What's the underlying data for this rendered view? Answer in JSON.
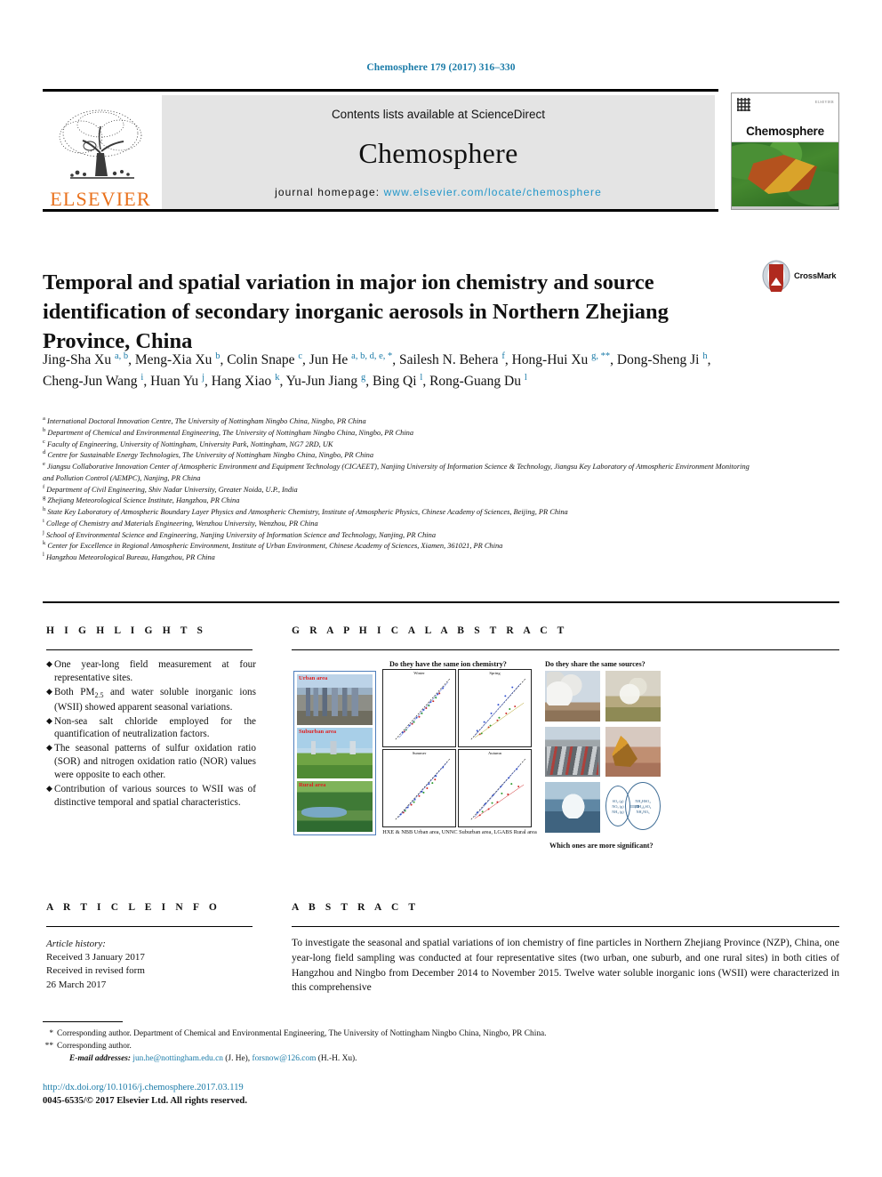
{
  "running_head": "Chemosphere 179 (2017) 316–330",
  "masthead": {
    "contents_prefix": "Contents lists available at ",
    "sciencedirect": "ScienceDirect",
    "journal_title": "Chemosphere",
    "homepage_prefix": "journal homepage: ",
    "homepage_url": "www.elsevier.com/locate/chemosphere",
    "publisher": "ELSEVIER",
    "cover_journal_name": "Chemosphere",
    "cover_publisher_mark": "ELSEVIER"
  },
  "crossmark": {
    "label": "CrossMark"
  },
  "article": {
    "title": "Temporal and spatial variation in major ion chemistry and source identification of secondary inorganic aerosols in Northern Zhejiang Province, China",
    "authors": [
      {
        "name": "Jing-Sha Xu",
        "sup": "a, b",
        "sep": ", "
      },
      {
        "name": "Meng-Xia Xu",
        "sup": "b",
        "sep": ", "
      },
      {
        "name": "Colin Snape",
        "sup": "c",
        "sep": ", "
      },
      {
        "name": "Jun He",
        "sup": "a, b, d, e, *",
        "sep": ", "
      },
      {
        "name": "Sailesh N. Behera",
        "sup": "f",
        "sep": ", "
      },
      {
        "name": "Hong-Hui Xu",
        "sup": "g, **",
        "sep": ", "
      },
      {
        "name": "Dong-Sheng Ji",
        "sup": "h",
        "sep": ", "
      },
      {
        "name": "Cheng-Jun Wang",
        "sup": "i",
        "sep": ", "
      },
      {
        "name": "Huan Yu",
        "sup": "j",
        "sep": ", "
      },
      {
        "name": "Hang Xiao",
        "sup": "k",
        "sep": ", "
      },
      {
        "name": "Yu-Jun Jiang",
        "sup": "g",
        "sep": ", "
      },
      {
        "name": "Bing Qi",
        "sup": "l",
        "sep": ", "
      },
      {
        "name": "Rong-Guang Du",
        "sup": "l",
        "sep": ""
      }
    ],
    "affiliations": [
      {
        "mark": "a",
        "text": "International Doctoral Innovation Centre, The University of Nottingham Ningbo China, Ningbo, PR China"
      },
      {
        "mark": "b",
        "text": "Department of Chemical and Environmental Engineering, The University of Nottingham Ningbo China, Ningbo, PR China"
      },
      {
        "mark": "c",
        "text": "Faculty of Engineering, University of Nottingham, University Park, Nottingham, NG7 2RD, UK"
      },
      {
        "mark": "d",
        "text": "Centre for Sustainable Energy Technologies, The University of Nottingham Ningbo China, Ningbo, PR China"
      },
      {
        "mark": "e",
        "text": "Jiangsu Collaborative Innovation Center of Atmospheric Environment and Equipment Technology (CICAEET), Nanjing University of Information Science & Technology, Jiangsu Key Laboratory of Atmospheric Environment Monitoring and Pollution Control (AEMPC), Nanjing, PR China"
      },
      {
        "mark": "f",
        "text": "Department of Civil Engineering, Shiv Nadar University, Greater Noida, U.P., India"
      },
      {
        "mark": "g",
        "text": "Zhejiang Meteorological Science Institute, Hangzhou, PR China"
      },
      {
        "mark": "h",
        "text": "State Key Laboratory of Atmospheric Boundary Layer Physics and Atmospheric Chemistry, Institute of Atmospheric Physics, Chinese Academy of Sciences, Beijing, PR China"
      },
      {
        "mark": "i",
        "text": "College of Chemistry and Materials Engineering, Wenzhou University, Wenzhou, PR China"
      },
      {
        "mark": "j",
        "text": "School of Environmental Science and Engineering, Nanjing University of Information Science and Technology, Nanjing, PR China"
      },
      {
        "mark": "k",
        "text": "Center for Excellence in Regional Atmospheric Environment, Institute of Urban Environment, Chinese Academy of Sciences, Xiamen, 361021, PR China"
      },
      {
        "mark": "l",
        "text": "Hangzhou Meteorological Bureau, Hangzhou, PR China"
      }
    ]
  },
  "highlights": {
    "heading": "H I G H L I G H T S",
    "bullet_glyph": "◆",
    "items": [
      {
        "pre": "One year-long field measurement at four representative sites.",
        "sub": "",
        "post": ""
      },
      {
        "pre": "Both PM",
        "sub": "2.5",
        "post": " and water soluble inorganic ions (WSII) showed apparent seasonal variations."
      },
      {
        "pre": "Non-sea salt chloride employed for the quantification of neutralization factors.",
        "sub": "",
        "post": ""
      },
      {
        "pre": "The seasonal patterns of sulfur oxidation ratio (SOR) and nitrogen oxidation ratio (NOR) values were opposite to each other.",
        "sub": "",
        "post": ""
      },
      {
        "pre": "Contribution of various sources to WSII was of distinctive temporal and spatial characteristics.",
        "sub": "",
        "post": ""
      }
    ]
  },
  "graphical_abstract": {
    "heading": "G R A P H I C A L   A B S T R A C T",
    "question_chemistry": "Do they have the same ion chemistry?",
    "question_sources": "Do they share the same sources?",
    "question_significant": "Which ones are more significant?",
    "site_labels": [
      "Urban area",
      "Suburban area",
      "Rural area"
    ],
    "plot_titles": [
      "Winter",
      "Spring",
      "Summer",
      "Autumn"
    ],
    "caption": "HXE & NBB Urban area,  UNNC Suburban area,  LGABS Rural area",
    "reaction": {
      "reactants": [
        "SO₂ (g)",
        "NOₓ (g)",
        "NH₃ (g)"
      ],
      "arrow": "⟹",
      "products": [
        "NH₄HSO₄",
        "(NH₄)₂SO₄",
        "NH₄NO₃"
      ]
    },
    "source_photo_labels": [
      "power-plant",
      "biomass-burning",
      "vehicle-traffic",
      "construction-dust",
      "sea-salt-spray",
      "reaction-diagram"
    ]
  },
  "article_info": {
    "heading": "A R T I C L E   I N F O",
    "history_label": "Article history:",
    "received": "Received 3 January 2017",
    "revised_label": "Received in revised form",
    "revised_date": "26 March 2017"
  },
  "abstract": {
    "heading": "A B S T R A C T",
    "text": "To investigate the seasonal and spatial variations of ion chemistry of fine particles in Northern Zhejiang Province (NZP), China, one year-long field sampling was conducted at four representative sites (two urban, one suburb, and one rural sites) in both cities of Hangzhou and Ningbo from December 2014 to November 2015. Twelve water soluble inorganic ions (WSII) were characterized in this comprehensive"
  },
  "footnotes": {
    "mark_single": "*",
    "corresponding_1": "Corresponding author. Department of Chemical and Environmental Engineering, The University of Nottingham Ningbo China, Ningbo, PR China.",
    "mark_double": "**",
    "corresponding_2": "Corresponding author.",
    "email_label": "E-mail addresses:",
    "email_1": "jun.he@nottingham.edu.cn",
    "email_1_owner": "(J. He),",
    "email_2": "forsnow@126.com",
    "email_2_owner": "(H.-H. Xu).",
    "doi": "http://dx.doi.org/10.1016/j.chemosphere.2017.03.119",
    "copyright": "0045-6535/© 2017 Elsevier Ltd. All rights reserved."
  },
  "colors": {
    "link_blue": "#1a7ba8",
    "sd_blue": "#2196c9",
    "elsevier_orange": "#E9711C",
    "sup_blue": "#1a7ba8",
    "label_red": "#e02020",
    "band_gray": "#e4e4e4"
  }
}
